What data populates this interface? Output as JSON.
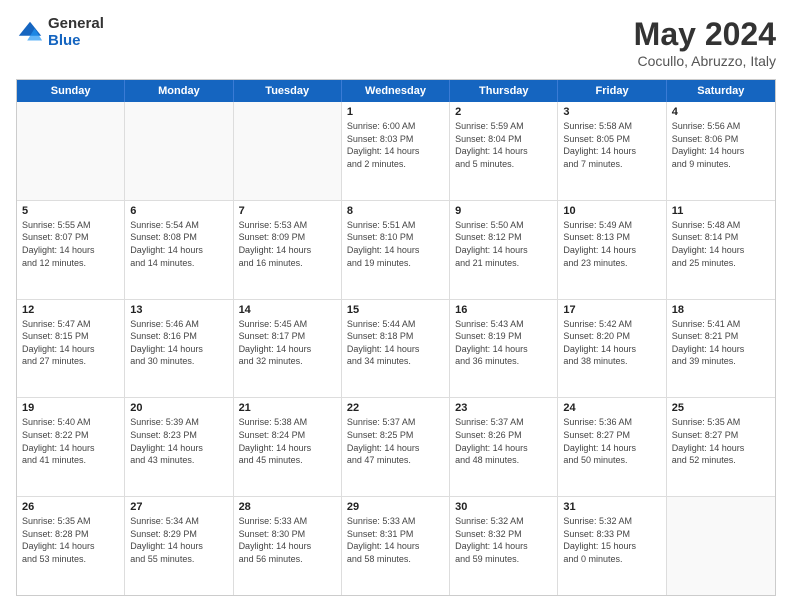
{
  "logo": {
    "general": "General",
    "blue": "Blue"
  },
  "title": "May 2024",
  "subtitle": "Cocullo, Abruzzo, Italy",
  "header_days": [
    "Sunday",
    "Monday",
    "Tuesday",
    "Wednesday",
    "Thursday",
    "Friday",
    "Saturday"
  ],
  "weeks": [
    [
      {
        "day": "",
        "info": ""
      },
      {
        "day": "",
        "info": ""
      },
      {
        "day": "",
        "info": ""
      },
      {
        "day": "1",
        "info": "Sunrise: 6:00 AM\nSunset: 8:03 PM\nDaylight: 14 hours\nand 2 minutes."
      },
      {
        "day": "2",
        "info": "Sunrise: 5:59 AM\nSunset: 8:04 PM\nDaylight: 14 hours\nand 5 minutes."
      },
      {
        "day": "3",
        "info": "Sunrise: 5:58 AM\nSunset: 8:05 PM\nDaylight: 14 hours\nand 7 minutes."
      },
      {
        "day": "4",
        "info": "Sunrise: 5:56 AM\nSunset: 8:06 PM\nDaylight: 14 hours\nand 9 minutes."
      }
    ],
    [
      {
        "day": "5",
        "info": "Sunrise: 5:55 AM\nSunset: 8:07 PM\nDaylight: 14 hours\nand 12 minutes."
      },
      {
        "day": "6",
        "info": "Sunrise: 5:54 AM\nSunset: 8:08 PM\nDaylight: 14 hours\nand 14 minutes."
      },
      {
        "day": "7",
        "info": "Sunrise: 5:53 AM\nSunset: 8:09 PM\nDaylight: 14 hours\nand 16 minutes."
      },
      {
        "day": "8",
        "info": "Sunrise: 5:51 AM\nSunset: 8:10 PM\nDaylight: 14 hours\nand 19 minutes."
      },
      {
        "day": "9",
        "info": "Sunrise: 5:50 AM\nSunset: 8:12 PM\nDaylight: 14 hours\nand 21 minutes."
      },
      {
        "day": "10",
        "info": "Sunrise: 5:49 AM\nSunset: 8:13 PM\nDaylight: 14 hours\nand 23 minutes."
      },
      {
        "day": "11",
        "info": "Sunrise: 5:48 AM\nSunset: 8:14 PM\nDaylight: 14 hours\nand 25 minutes."
      }
    ],
    [
      {
        "day": "12",
        "info": "Sunrise: 5:47 AM\nSunset: 8:15 PM\nDaylight: 14 hours\nand 27 minutes."
      },
      {
        "day": "13",
        "info": "Sunrise: 5:46 AM\nSunset: 8:16 PM\nDaylight: 14 hours\nand 30 minutes."
      },
      {
        "day": "14",
        "info": "Sunrise: 5:45 AM\nSunset: 8:17 PM\nDaylight: 14 hours\nand 32 minutes."
      },
      {
        "day": "15",
        "info": "Sunrise: 5:44 AM\nSunset: 8:18 PM\nDaylight: 14 hours\nand 34 minutes."
      },
      {
        "day": "16",
        "info": "Sunrise: 5:43 AM\nSunset: 8:19 PM\nDaylight: 14 hours\nand 36 minutes."
      },
      {
        "day": "17",
        "info": "Sunrise: 5:42 AM\nSunset: 8:20 PM\nDaylight: 14 hours\nand 38 minutes."
      },
      {
        "day": "18",
        "info": "Sunrise: 5:41 AM\nSunset: 8:21 PM\nDaylight: 14 hours\nand 39 minutes."
      }
    ],
    [
      {
        "day": "19",
        "info": "Sunrise: 5:40 AM\nSunset: 8:22 PM\nDaylight: 14 hours\nand 41 minutes."
      },
      {
        "day": "20",
        "info": "Sunrise: 5:39 AM\nSunset: 8:23 PM\nDaylight: 14 hours\nand 43 minutes."
      },
      {
        "day": "21",
        "info": "Sunrise: 5:38 AM\nSunset: 8:24 PM\nDaylight: 14 hours\nand 45 minutes."
      },
      {
        "day": "22",
        "info": "Sunrise: 5:37 AM\nSunset: 8:25 PM\nDaylight: 14 hours\nand 47 minutes."
      },
      {
        "day": "23",
        "info": "Sunrise: 5:37 AM\nSunset: 8:26 PM\nDaylight: 14 hours\nand 48 minutes."
      },
      {
        "day": "24",
        "info": "Sunrise: 5:36 AM\nSunset: 8:27 PM\nDaylight: 14 hours\nand 50 minutes."
      },
      {
        "day": "25",
        "info": "Sunrise: 5:35 AM\nSunset: 8:27 PM\nDaylight: 14 hours\nand 52 minutes."
      }
    ],
    [
      {
        "day": "26",
        "info": "Sunrise: 5:35 AM\nSunset: 8:28 PM\nDaylight: 14 hours\nand 53 minutes."
      },
      {
        "day": "27",
        "info": "Sunrise: 5:34 AM\nSunset: 8:29 PM\nDaylight: 14 hours\nand 55 minutes."
      },
      {
        "day": "28",
        "info": "Sunrise: 5:33 AM\nSunset: 8:30 PM\nDaylight: 14 hours\nand 56 minutes."
      },
      {
        "day": "29",
        "info": "Sunrise: 5:33 AM\nSunset: 8:31 PM\nDaylight: 14 hours\nand 58 minutes."
      },
      {
        "day": "30",
        "info": "Sunrise: 5:32 AM\nSunset: 8:32 PM\nDaylight: 14 hours\nand 59 minutes."
      },
      {
        "day": "31",
        "info": "Sunrise: 5:32 AM\nSunset: 8:33 PM\nDaylight: 15 hours\nand 0 minutes."
      },
      {
        "day": "",
        "info": ""
      }
    ]
  ]
}
